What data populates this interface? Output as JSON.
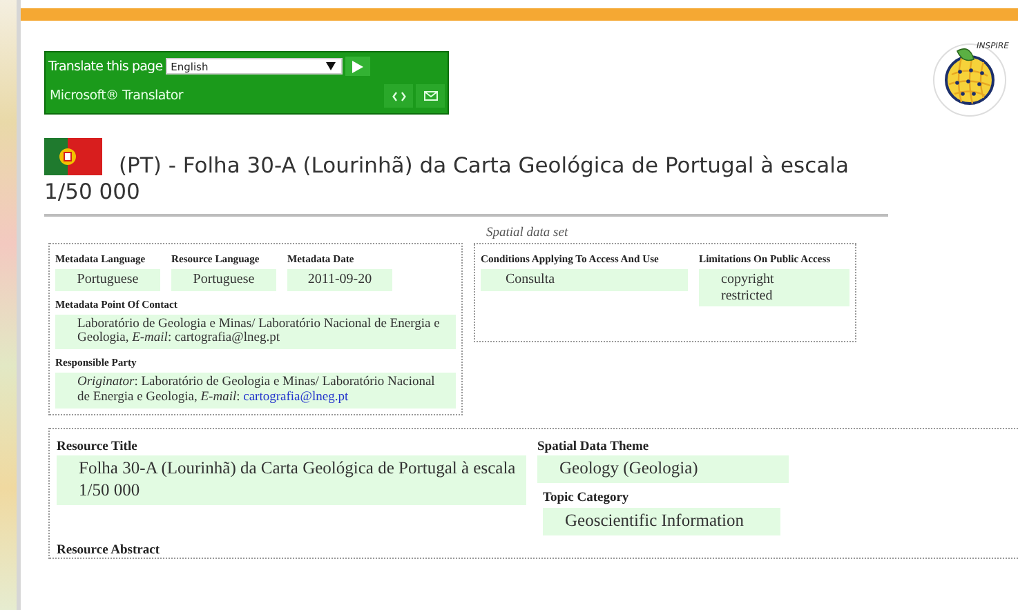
{
  "translator": {
    "label": "Translate this page",
    "language": "English",
    "brand": "Microsoft® Translator"
  },
  "logo": {
    "text": "INSPIRE"
  },
  "title": "(PT) - Folha 30-A (Lourinhã) da Carta Geológica de Portugal à escala 1/50 000",
  "resource_type": "Spatial data set",
  "metadata_panel": {
    "fields": [
      {
        "label": "Metadata Language",
        "value": "Portuguese"
      },
      {
        "label": "Resource Language",
        "value": "Portuguese"
      },
      {
        "label": "Metadata Date",
        "value": "2011-09-20"
      }
    ],
    "point_of_contact": {
      "label": "Metadata Point Of Contact",
      "value": "Laboratório de Geologia e Minas/ Laboratório Nacional de Energia e Geologia, *E-mail*: cartografia@lneg.pt"
    },
    "responsible_party": {
      "label": "Responsible Party",
      "value": "*Originator*: Laboratório de Geologia e Minas/ Laboratório Nacional de Energia e Geologia, *E-mail*:",
      "email": "cartografia@lneg.pt"
    }
  },
  "access_panel": {
    "columns": [
      {
        "label": "Conditions Applying To Access And Use",
        "values": [
          "Consulta"
        ]
      },
      {
        "label": "Limitations On Public Access",
        "values": [
          "copyright",
          "restricted"
        ]
      }
    ]
  },
  "resource_panel": {
    "title": {
      "label": "Resource Title",
      "value": "Folha 30-A (Lourinhã) da Carta Geológica de Portugal à escala 1/50 000"
    },
    "theme": {
      "label": "Spatial Data Theme",
      "value": "Geology (Geologia)"
    },
    "topic": {
      "label": "Topic Category",
      "value": "Geoscientific Information"
    },
    "abstract": {
      "label": "Resource Abstract"
    }
  }
}
